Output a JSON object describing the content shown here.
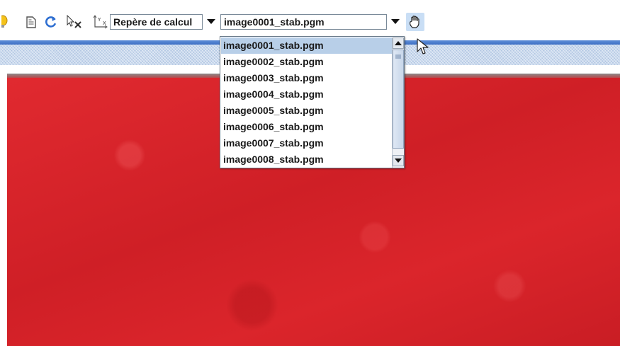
{
  "toolbar": {
    "icons": [
      "lightbulb-icon",
      "document-icon",
      "refresh-icon",
      "select-cursor-icon",
      "coordinate-axes-icon",
      "hand-pan-icon"
    ],
    "axes_icon_labels": {
      "y": "Y",
      "x": "X"
    },
    "frame_select": {
      "value": "Repère de calcul"
    },
    "image_select": {
      "value": "image0001_stab.pgm"
    }
  },
  "image_dropdown": {
    "options": [
      "image0001_stab.pgm",
      "image0002_stab.pgm",
      "image0003_stab.pgm",
      "image0004_stab.pgm",
      "image0005_stab.pgm",
      "image0006_stab.pgm",
      "image0007_stab.pgm",
      "image0008_stab.pgm"
    ],
    "selected_index": 0
  },
  "colors": {
    "image_red": "#d8232a",
    "selection_blue": "#b8cfe8",
    "accent_blue": "#3d6fc4"
  }
}
